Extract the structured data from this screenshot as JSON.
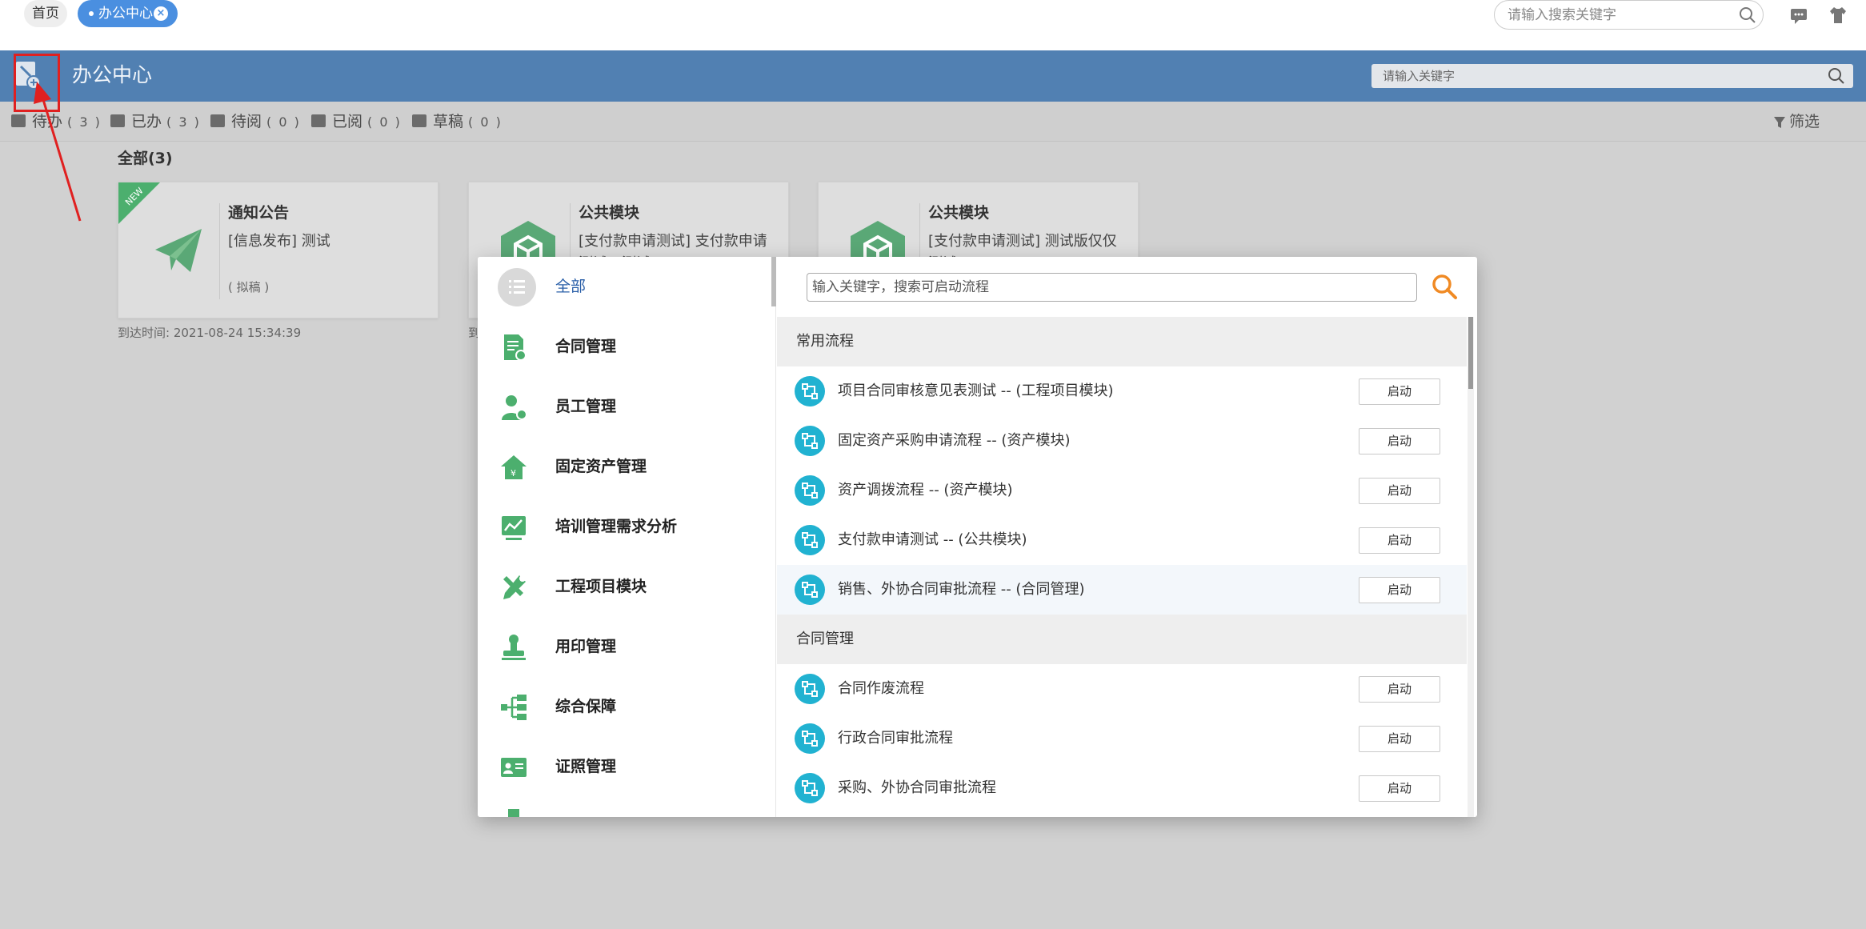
{
  "topbar": {
    "tabs": [
      {
        "label": "首页"
      },
      {
        "label": "办公中心"
      }
    ],
    "search_placeholder": "请输入搜索关键字",
    "icons": [
      "search-icon",
      "message-icon",
      "shirt-icon"
    ]
  },
  "header": {
    "title": "办公中心",
    "search_placeholder": "请输入关键字"
  },
  "statusbar": {
    "tabs": [
      {
        "label": "待办",
        "count": "( 3 )"
      },
      {
        "label": "已办",
        "count": "( 3 )"
      },
      {
        "label": "待阅",
        "count": "( 0 )"
      },
      {
        "label": "已阅",
        "count": "( 0 )"
      },
      {
        "label": "草稿",
        "count": "( 0 )"
      }
    ],
    "filter_label": "筛选"
  },
  "section_title": "全部(3)",
  "cards": [
    {
      "title": "通知公告",
      "desc": "[信息发布]  测试",
      "status": "( 拟稿 )",
      "badge": "NEW",
      "arrival": "到达时间: 2021-08-24 15:34:39"
    },
    {
      "title": "公共模块",
      "desc": "[支付款申请测试]  支付款申请测试：测试",
      "arrival": "到"
    },
    {
      "title": "公共模块",
      "desc": "[支付款申请测试]  测试版仅仅测试"
    }
  ],
  "modal": {
    "search_placeholder": "输入关键字，搜索可启动流程",
    "categories": [
      {
        "label": "全部",
        "icon": "list-icon"
      },
      {
        "label": "合同管理",
        "icon": "contract-icon"
      },
      {
        "label": "员工管理",
        "icon": "employee-icon"
      },
      {
        "label": "固定资产管理",
        "icon": "house-icon"
      },
      {
        "label": "培训管理需求分析",
        "icon": "chart-icon"
      },
      {
        "label": "工程项目模块",
        "icon": "tools-icon"
      },
      {
        "label": "用印管理",
        "icon": "stamp-icon"
      },
      {
        "label": "综合保障",
        "icon": "tree-icon"
      },
      {
        "label": "证照管理",
        "icon": "id-card-icon"
      }
    ],
    "groups": [
      {
        "title": "常用流程",
        "rows": [
          {
            "label": "项目合同审核意见表测试 -- (工程项目模块)"
          },
          {
            "label": "固定资产采购申请流程 -- (资产模块)"
          },
          {
            "label": "资产调拨流程 -- (资产模块)"
          },
          {
            "label": "支付款申请测试 -- (公共模块)"
          },
          {
            "label": "销售、外协合同审批流程 -- (合同管理)"
          }
        ]
      },
      {
        "title": "合同管理",
        "rows": [
          {
            "label": "合同作废流程"
          },
          {
            "label": "行政合同审批流程"
          },
          {
            "label": "采购、外协合同审批流程"
          }
        ]
      }
    ],
    "start_label": "启动"
  },
  "colors": {
    "accent": "#4a8fe0",
    "header": "#5180b2",
    "green": "#4caf6e",
    "flow_icon": "#21b2d1",
    "search_orange": "#f08a24",
    "annotation_red": "#e02020"
  }
}
